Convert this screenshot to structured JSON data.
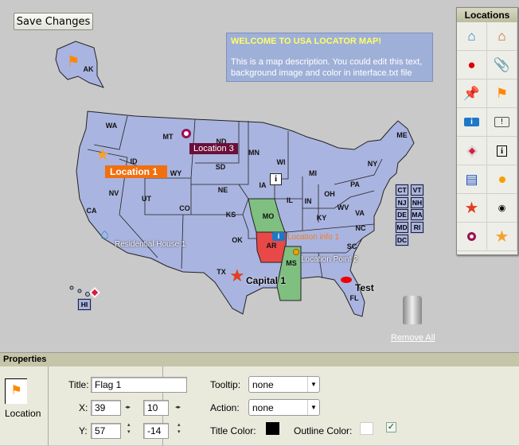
{
  "toolbar": {
    "save_label": "Save Changes"
  },
  "description": {
    "title": "WELCOME TO USA LOCATOR MAP!",
    "text": "This is a map description. You could edit this text, background image and color in interface.txt file"
  },
  "locations_panel": {
    "title": "Locations",
    "icons": [
      "house-blue-icon",
      "house-orange-icon",
      "pushpin-red-icon",
      "paperclip-icon",
      "thumbtack-icon",
      "flag-icon",
      "info-blue-icon",
      "exclamation-bubble-icon",
      "diamond-icon",
      "info-box-icon",
      "notepad-icon",
      "orange-dot-icon",
      "red-star-icon",
      "target-dot-icon",
      "ring-icon",
      "orange-star-icon"
    ]
  },
  "map": {
    "colors": {
      "state_fill": "#aab4e0",
      "highlight_green": "#7fbf7f",
      "highlight_red": "#e84848"
    },
    "states": [
      "WA",
      "MT",
      "ND",
      "MN",
      "WI",
      "MI",
      "ME",
      "NY",
      "ID",
      "WY",
      "SD",
      "IA",
      "NV",
      "UT",
      "CO",
      "NE",
      "IL",
      "IN",
      "OH",
      "PA",
      "CA",
      "KS",
      "MO",
      "KY",
      "WV",
      "VA",
      "NC",
      "OK",
      "AR",
      "SC",
      "TX",
      "MS",
      "FL",
      "AK"
    ],
    "small_states": [
      "CT",
      "VT",
      "NJ",
      "NH",
      "DE",
      "MA",
      "MD",
      "RI",
      "DC",
      "HI"
    ],
    "markers": {
      "location1": "Location 1",
      "location3": "Location 3",
      "residential": "Residential House 1",
      "info1": "Location info 1",
      "point2": "Location Point 2",
      "capital": "Capital 1",
      "test": "Test"
    },
    "remove_all": "Remove All"
  },
  "properties": {
    "header": "Properties",
    "preview_label": "Location",
    "title_label": "Title:",
    "title_value": "Flag 1",
    "x_label": "X:",
    "x_value": "39",
    "x_offset": "10",
    "y_label": "Y:",
    "y_value": "57",
    "y_offset": "-14",
    "tooltip_label": "Tooltip:",
    "tooltip_value": "none",
    "action_label": "Action:",
    "action_value": "none",
    "title_color_label": "Title Color:",
    "title_color": "#000000",
    "outline_color_label": "Outline Color:",
    "outline_color": "#ffffff",
    "outline_checked": true
  }
}
